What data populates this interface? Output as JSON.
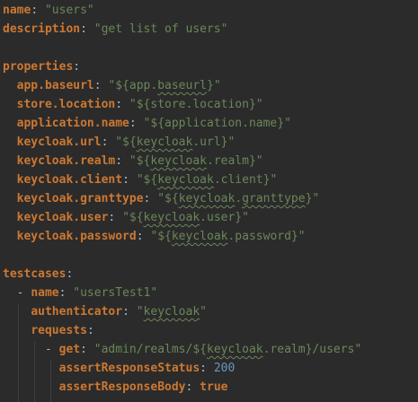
{
  "lines": [
    [
      {
        "t": "name",
        "c": "key"
      },
      {
        "t": ": ",
        "c": "plain"
      },
      {
        "t": "\"users\"",
        "c": "str"
      }
    ],
    [
      {
        "t": "description",
        "c": "key"
      },
      {
        "t": ": ",
        "c": "plain"
      },
      {
        "t": "\"get list of users\"",
        "c": "str"
      }
    ],
    [],
    [
      {
        "t": "properties",
        "c": "key"
      },
      {
        "t": ":",
        "c": "plain"
      }
    ],
    [
      {
        "t": "  ",
        "c": "plain"
      },
      {
        "t": "app.baseurl",
        "c": "key"
      },
      {
        "t": ": ",
        "c": "plain"
      },
      {
        "t": "\"${app.",
        "c": "str"
      },
      {
        "t": "baseurl",
        "c": "str sq"
      },
      {
        "t": "}\"",
        "c": "str"
      }
    ],
    [
      {
        "t": "  ",
        "c": "plain"
      },
      {
        "t": "store.location",
        "c": "key"
      },
      {
        "t": ": ",
        "c": "plain"
      },
      {
        "t": "\"${store.location}\"",
        "c": "str"
      }
    ],
    [
      {
        "t": "  ",
        "c": "plain"
      },
      {
        "t": "application.name",
        "c": "key"
      },
      {
        "t": ": ",
        "c": "plain"
      },
      {
        "t": "\"${application.name}\"",
        "c": "str"
      }
    ],
    [
      {
        "t": "  ",
        "c": "plain"
      },
      {
        "t": "keycloak.url",
        "c": "key"
      },
      {
        "t": ": ",
        "c": "plain"
      },
      {
        "t": "\"${",
        "c": "str"
      },
      {
        "t": "keycloak",
        "c": "str sq"
      },
      {
        "t": ".url}\"",
        "c": "str"
      }
    ],
    [
      {
        "t": "  ",
        "c": "plain"
      },
      {
        "t": "keycloak.realm",
        "c": "key"
      },
      {
        "t": ": ",
        "c": "plain"
      },
      {
        "t": "\"${",
        "c": "str"
      },
      {
        "t": "keycloak",
        "c": "str sq"
      },
      {
        "t": ".realm}\"",
        "c": "str"
      }
    ],
    [
      {
        "t": "  ",
        "c": "plain"
      },
      {
        "t": "keycloak.client",
        "c": "key"
      },
      {
        "t": ": ",
        "c": "plain"
      },
      {
        "t": "\"${",
        "c": "str"
      },
      {
        "t": "keycloak",
        "c": "str sq"
      },
      {
        "t": ".client}\"",
        "c": "str"
      }
    ],
    [
      {
        "t": "  ",
        "c": "plain"
      },
      {
        "t": "keycloak.granttype",
        "c": "key"
      },
      {
        "t": ": ",
        "c": "plain"
      },
      {
        "t": "\"${",
        "c": "str"
      },
      {
        "t": "keycloak",
        "c": "str sq"
      },
      {
        "t": ".",
        "c": "str"
      },
      {
        "t": "granttype",
        "c": "str sq"
      },
      {
        "t": "}\"",
        "c": "str"
      }
    ],
    [
      {
        "t": "  ",
        "c": "plain"
      },
      {
        "t": "keycloak.user",
        "c": "key"
      },
      {
        "t": ": ",
        "c": "plain"
      },
      {
        "t": "\"${",
        "c": "str"
      },
      {
        "t": "keycloak",
        "c": "str sq"
      },
      {
        "t": ".user}\"",
        "c": "str"
      }
    ],
    [
      {
        "t": "  ",
        "c": "plain"
      },
      {
        "t": "keycloak.password",
        "c": "key"
      },
      {
        "t": ": ",
        "c": "plain"
      },
      {
        "t": "\"${",
        "c": "str"
      },
      {
        "t": "keycloak",
        "c": "str sq"
      },
      {
        "t": ".password}\"",
        "c": "str"
      }
    ],
    [],
    [
      {
        "t": "testcases",
        "c": "key"
      },
      {
        "t": ":",
        "c": "plain"
      }
    ],
    [
      {
        "t": "  - ",
        "c": "plain"
      },
      {
        "t": "name",
        "c": "key"
      },
      {
        "t": ": ",
        "c": "plain"
      },
      {
        "t": "\"usersTest1\"",
        "c": "str"
      }
    ],
    [
      {
        "t": "    ",
        "c": "plain"
      },
      {
        "t": "authenticator",
        "c": "key"
      },
      {
        "t": ": ",
        "c": "plain"
      },
      {
        "t": "\"",
        "c": "str"
      },
      {
        "t": "keycloak",
        "c": "str sq"
      },
      {
        "t": "\"",
        "c": "str"
      }
    ],
    [
      {
        "t": "    ",
        "c": "plain"
      },
      {
        "t": "requests",
        "c": "key"
      },
      {
        "t": ":",
        "c": "plain"
      }
    ],
    [
      {
        "t": "      - ",
        "c": "plain"
      },
      {
        "t": "get",
        "c": "key"
      },
      {
        "t": ": ",
        "c": "plain"
      },
      {
        "t": "\"admin/realms/${",
        "c": "str"
      },
      {
        "t": "keycloak",
        "c": "str sq"
      },
      {
        "t": ".realm}/users\"",
        "c": "str"
      }
    ],
    [
      {
        "t": "        ",
        "c": "plain"
      },
      {
        "t": "assertResponseStatus",
        "c": "key"
      },
      {
        "t": ": ",
        "c": "plain"
      },
      {
        "t": "200",
        "c": "num"
      }
    ],
    [
      {
        "t": "        ",
        "c": "plain"
      },
      {
        "t": "assertResponseBody",
        "c": "key"
      },
      {
        "t": ": ",
        "c": "plain"
      },
      {
        "t": "true",
        "c": "bool"
      }
    ]
  ]
}
